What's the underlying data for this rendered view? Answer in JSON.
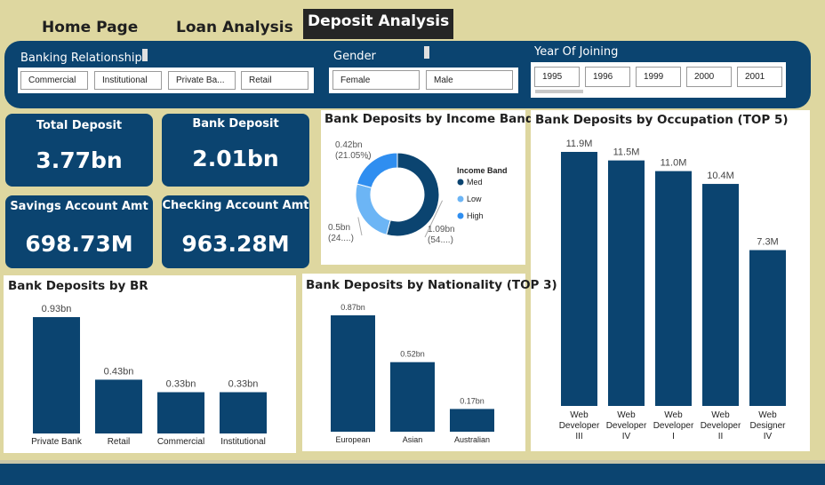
{
  "nav": {
    "home": "Home Page",
    "loan": "Loan Analysis",
    "deposit": "Deposit Analysis"
  },
  "filters": {
    "banking_relationship": {
      "label": "Banking Relationship",
      "options": [
        "Commercial",
        "Institutional",
        "Private Ba...",
        "Retail"
      ]
    },
    "gender": {
      "label": "Gender",
      "options": [
        "Female",
        "Male"
      ]
    },
    "year": {
      "label": "Year Of Joining",
      "options": [
        "1995",
        "1996",
        "1999",
        "2000",
        "2001"
      ]
    }
  },
  "kpis": {
    "total_deposit": {
      "title": "Total Deposit",
      "value": "3.77bn"
    },
    "bank_deposit": {
      "title": "Bank Deposit",
      "value": "2.01bn"
    },
    "savings": {
      "title": "Savings Account Amt",
      "value": "698.73M"
    },
    "checking": {
      "title": "Checking Account Amt",
      "value": "963.28M"
    }
  },
  "colors": {
    "primary": "#0b4470",
    "background": "#ded7a0",
    "light_blue": "#6cb5f5",
    "mid_blue": "#2f8ef0"
  },
  "chart_data": [
    {
      "id": "income_band",
      "type": "pie",
      "title": "Bank Deposits by Income Band",
      "legend_title": "Income Band",
      "legend_position": "right",
      "categories": [
        "Med",
        "Low",
        "High"
      ],
      "values": [
        1.09,
        0.5,
        0.42
      ],
      "labels": [
        [
          "1.09bn",
          "(54....)"
        ],
        [
          "0.5bn",
          "(24....)"
        ],
        [
          "0.42bn",
          "(21.05%)"
        ]
      ],
      "colors": [
        "#0b4470",
        "#6cb5f5",
        "#2f8ef0"
      ]
    },
    {
      "id": "occupation",
      "type": "bar",
      "title": "Bank Deposits by Occupation (TOP 5)",
      "categories": [
        [
          "Web",
          "Developer",
          "III"
        ],
        [
          "Web",
          "Developer",
          "IV"
        ],
        [
          "Web",
          "Developer",
          "I"
        ],
        [
          "Web",
          "Developer",
          "II"
        ],
        [
          "Web",
          "Designer",
          "IV"
        ]
      ],
      "values": [
        11.9,
        11.5,
        11.0,
        10.4,
        7.3
      ],
      "data_labels": [
        "11.9M",
        "11.5M",
        "11.0M",
        "10.4M",
        "7.3M"
      ],
      "unit": "M"
    },
    {
      "id": "br",
      "type": "bar",
      "title": "Bank Deposits by BR",
      "categories": [
        "Private Bank",
        "Retail",
        "Commercial",
        "Institutional"
      ],
      "values": [
        0.93,
        0.43,
        0.33,
        0.33
      ],
      "data_labels": [
        "0.93bn",
        "0.43bn",
        "0.33bn",
        "0.33bn"
      ],
      "unit": "bn"
    },
    {
      "id": "nationality",
      "type": "bar",
      "title": "Bank Deposits by Nationality (TOP 3)",
      "categories": [
        "European",
        "Asian",
        "Australian"
      ],
      "values": [
        0.87,
        0.52,
        0.17
      ],
      "data_labels": [
        "0.87bn",
        "0.52bn",
        "0.17bn"
      ],
      "unit": "bn"
    }
  ]
}
